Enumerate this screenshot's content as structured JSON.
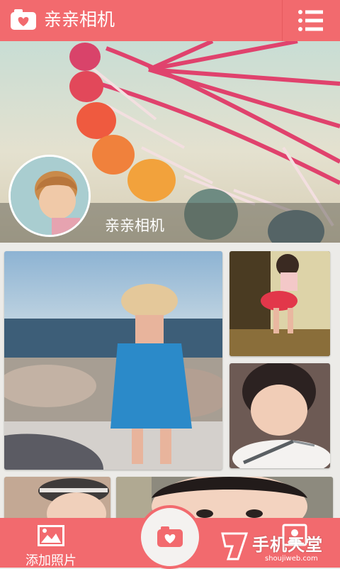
{
  "header": {
    "title": "亲亲相机",
    "logo_icon": "heart-camera-icon",
    "menu_icon": "list-menu-icon"
  },
  "cover": {
    "name": "亲亲相机",
    "avatar": "child-avatar-photo"
  },
  "grid": {
    "photos": [
      "girl-with-hat-at-seaside",
      "toddler-in-red-skirt",
      "girl-eating-with-fork",
      "girl-in-cap",
      "girl-face-closeup"
    ]
  },
  "bottom": {
    "add_label": "添加照片",
    "add_icon": "picture-icon",
    "shutter_icon": "camera-heart-icon",
    "profile_icon": "contact-card-icon"
  },
  "watermark": {
    "brand": "手机天堂",
    "url": "shoujiweb.com"
  },
  "colors": {
    "accent": "#f26a6e",
    "background": "#ecebe8"
  }
}
